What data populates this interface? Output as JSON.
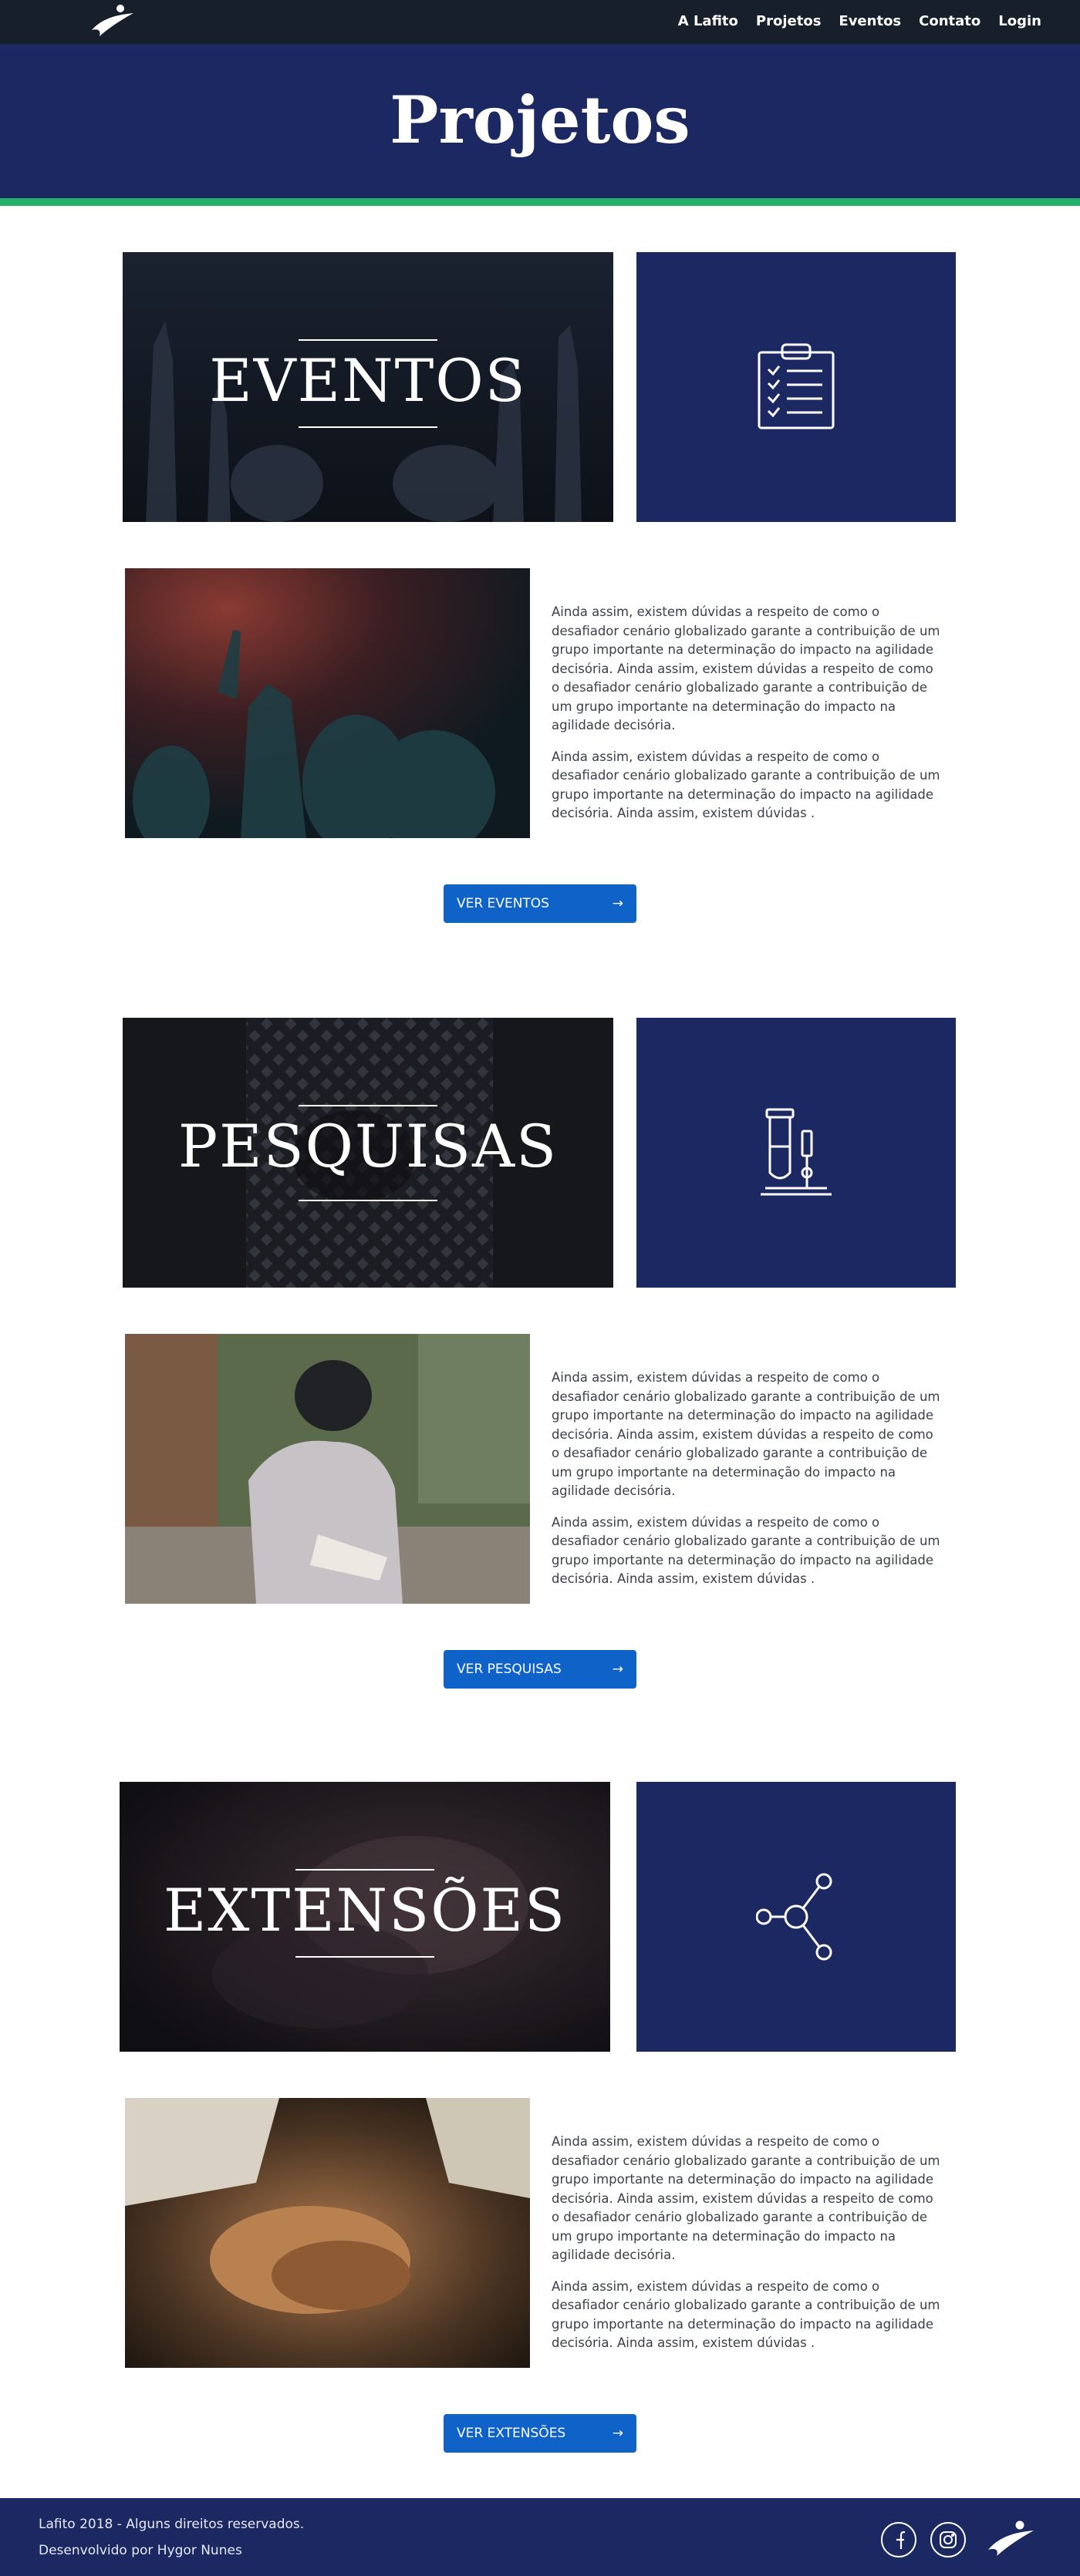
{
  "nav": {
    "logo_icon": "lafito-logo-icon",
    "links": [
      "A Lafito",
      "Projetos",
      "Eventos",
      "Contato",
      "Login"
    ]
  },
  "hero": {
    "title": "Projetos",
    "stripe_color": "#25b06a",
    "background_color": "#1c2862"
  },
  "sections": [
    {
      "banner_title": "EVENTOS",
      "icon": "clipboard-checklist-icon",
      "paragraphs": [
        "Ainda assim, existem dúvidas a respeito de como o desafiador cenário globalizado garante a contribuição de um grupo importante na determinação do impacto na agilidade decisória. Ainda assim, existem dúvidas a respeito de como o desafiador cenário globalizado garante a contribuição de um grupo importante na determinação do impacto na agilidade decisória.",
        "Ainda assim, existem dúvidas a respeito de como o desafiador cenário globalizado garante a contribuição de um grupo importante na determinação do impacto na agilidade decisória. Ainda assim, existem dúvidas ."
      ],
      "button_label": "VER EVENTOS"
    },
    {
      "banner_title": "PESQUISAS",
      "icon": "test-tube-microscope-icon",
      "paragraphs": [
        "Ainda assim, existem dúvidas a respeito de como o desafiador cenário globalizado garante a contribuição de um grupo importante na determinação do impacto na agilidade decisória. Ainda assim, existem dúvidas a respeito de como o desafiador cenário globalizado garante a contribuição de um grupo importante na determinação do impacto na agilidade decisória.",
        "Ainda assim, existem dúvidas a respeito de como o desafiador cenário globalizado garante a contribuição de um grupo importante na determinação do impacto na agilidade decisória. Ainda assim, existem dúvidas ."
      ],
      "button_label": "VER PESQUISAS"
    },
    {
      "banner_title": "EXTENSÕES",
      "icon": "share-network-icon",
      "paragraphs": [
        "Ainda assim, existem dúvidas a respeito de como o desafiador cenário globalizado garante a contribuição de um grupo importante na determinação do impacto na agilidade decisória. Ainda assim, existem dúvidas a respeito de como o desafiador cenário globalizado garante a contribuição de um grupo importante na determinação do impacto na agilidade decisória.",
        "Ainda assim, existem dúvidas a respeito de como o desafiador cenário globalizado garante a contribuição de um grupo importante na determinação do impacto na agilidade decisória. Ainda assim, existem dúvidas ."
      ],
      "button_label": "VER EXTENSÕES"
    }
  ],
  "footer": {
    "copyright": "Lafito 2018 - Alguns direitos reservados.",
    "credit": "Desenvolvido por Hygor Nunes",
    "social_icons": [
      "facebook-icon",
      "instagram-icon"
    ]
  },
  "colors": {
    "navy": "#1c2862",
    "nav_bg": "#161f2a",
    "button_blue": "#0f63c8",
    "accent_green": "#25b06a"
  }
}
